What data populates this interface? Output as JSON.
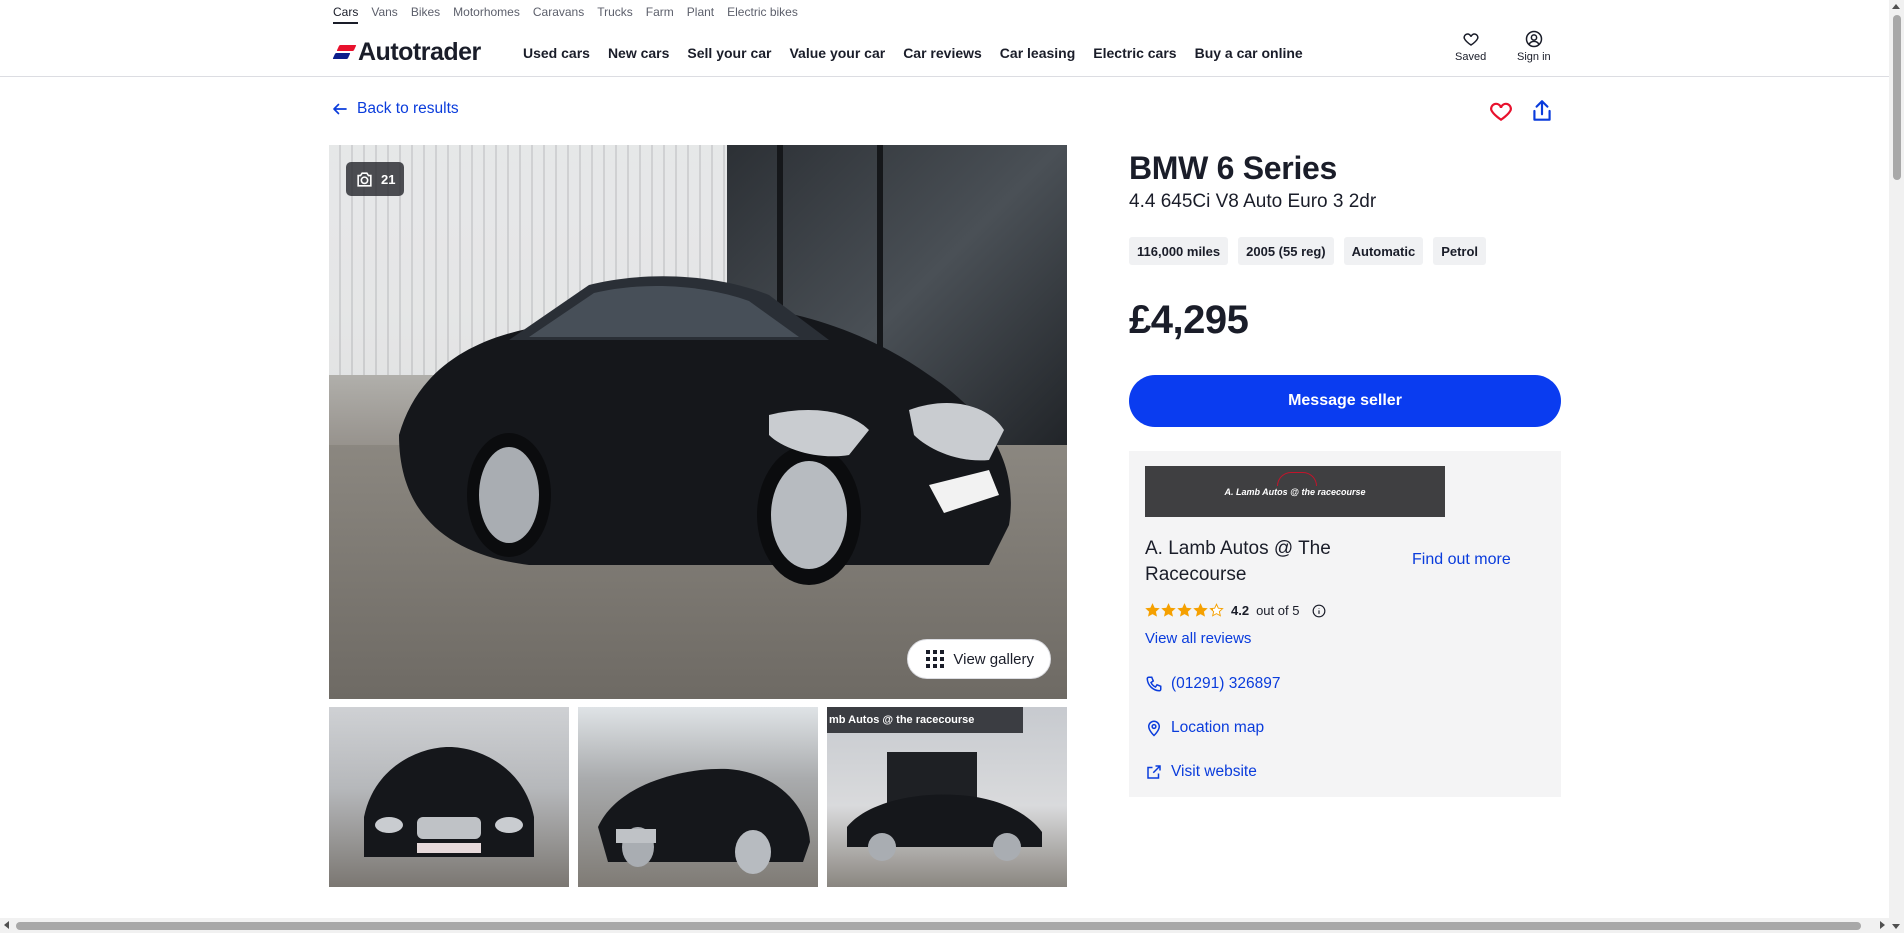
{
  "vehicle_types": [
    "Cars",
    "Vans",
    "Bikes",
    "Motorhomes",
    "Caravans",
    "Trucks",
    "Farm",
    "Plant",
    "Electric bikes"
  ],
  "active_vehicle_type": "Cars",
  "brand": {
    "name": "Autotrader",
    "colors": {
      "red": "#e8112d",
      "navy": "#0c1f8c",
      "accent_blue": "#0a3cf0"
    }
  },
  "nav": [
    "Used cars",
    "New cars",
    "Sell your car",
    "Value your car",
    "Car reviews",
    "Car leasing",
    "Electric cars",
    "Buy a car online"
  ],
  "header_actions": {
    "saved_label": "Saved",
    "signin_label": "Sign in",
    "saved_icon": "heart-icon",
    "signin_icon": "user-icon"
  },
  "back_label": "Back to results",
  "gallery": {
    "photo_count": "21",
    "view_gallery_label": "View gallery",
    "thumbnail_banner_text": "mb Autos @ the racecourse"
  },
  "listing": {
    "title": "BMW 6 Series",
    "subtitle": "4.4 645Ci V8 Auto Euro 3 2dr",
    "specs": [
      "116,000 miles",
      "2005 (55 reg)",
      "Automatic",
      "Petrol"
    ],
    "price": "£4,295",
    "message_button": "Message seller"
  },
  "dealer": {
    "logo_text": "A. Lamb Autos @ the racecourse",
    "name": "A. Lamb Autos @ The Racecourse",
    "find_out_more": "Find out more",
    "rating_value": "4.2",
    "rating_suffix": "out of 5",
    "rating_stars": 4.2,
    "view_reviews": "View all reviews",
    "phone": "(01291) 326897",
    "location_label": "Location map",
    "website_label": "Visit website"
  }
}
